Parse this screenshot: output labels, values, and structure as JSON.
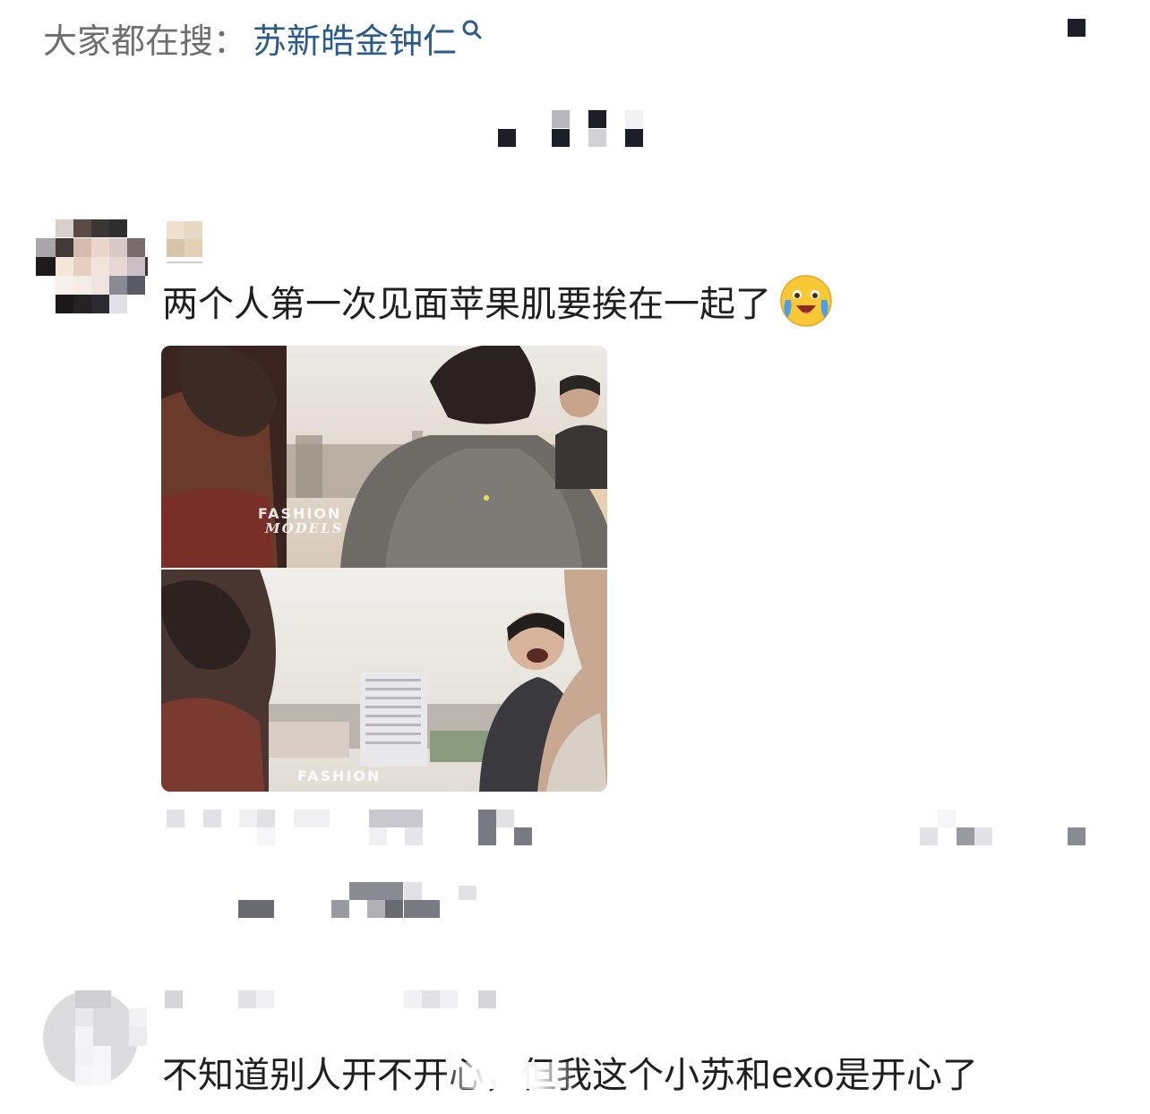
{
  "search": {
    "prefix": "大家都在搜：",
    "term": "苏新皓金钟仁"
  },
  "comments": [
    {
      "text": "两个人第一次见面苹果肌要挨在一起了",
      "emoji": "crying-laughing-emoji",
      "image": {
        "watermark_top": "FASHION",
        "watermark_sub": "MODELS",
        "watermark_bottom": "FASHION"
      }
    },
    {
      "text": "不知道别人开不开心，但我这个小苏和exo是开心了"
    }
  ],
  "colors": {
    "search_prefix": "#6e6e6e",
    "search_term": "#2a5b8a",
    "text": "#1f1f1f"
  }
}
